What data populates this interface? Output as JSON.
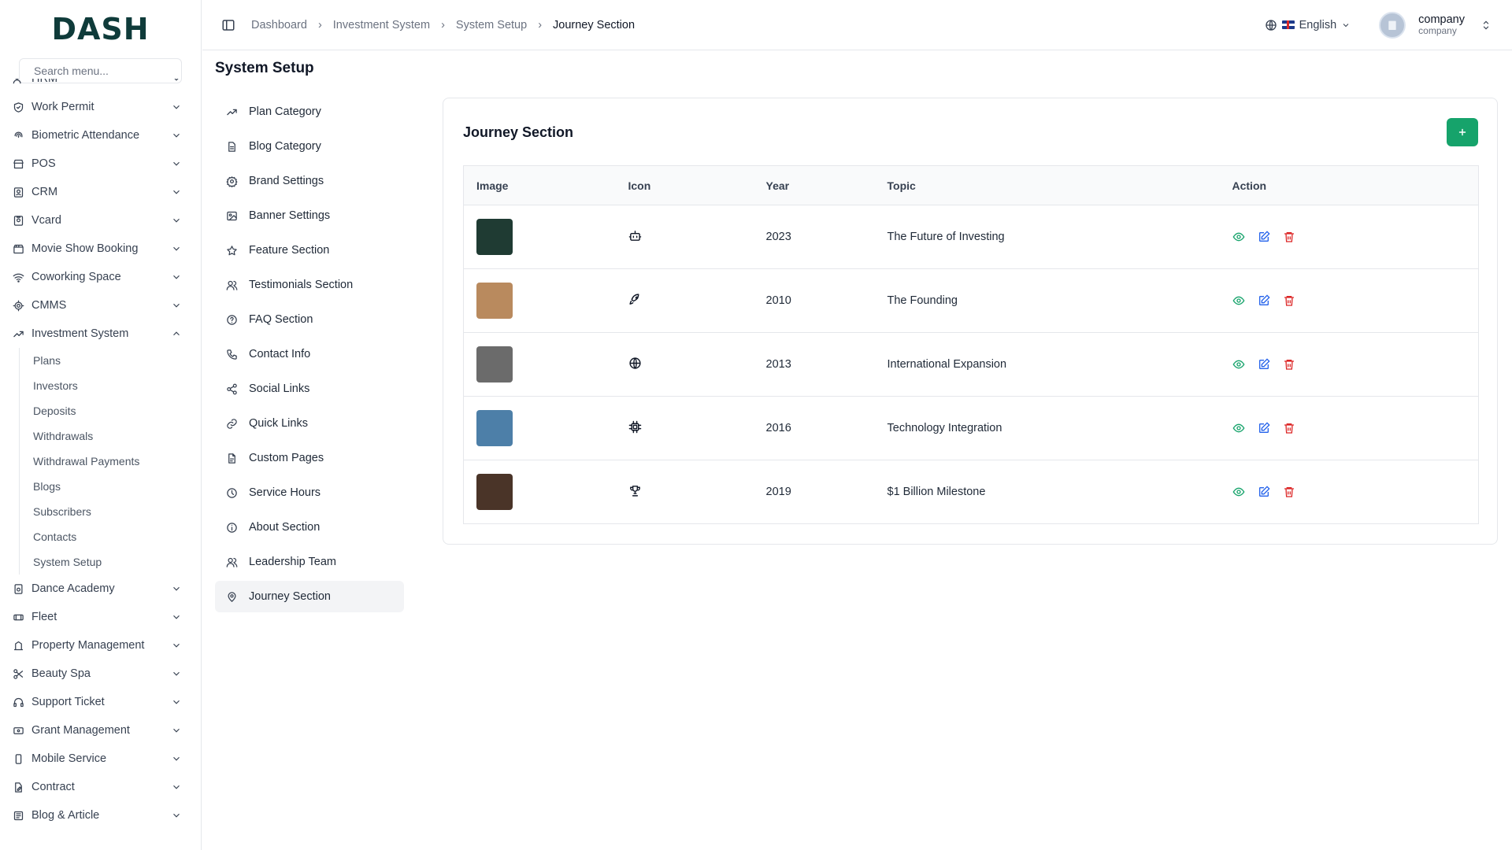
{
  "app": {
    "logo": "DASH"
  },
  "search": {
    "placeholder": "Search menu..."
  },
  "sidebar": {
    "cut_item": "HRM",
    "items": [
      {
        "label": "Work Permit",
        "icon": "shield-check-icon"
      },
      {
        "label": "Biometric Attendance",
        "icon": "fingerprint-icon"
      },
      {
        "label": "POS",
        "icon": "store-icon"
      },
      {
        "label": "CRM",
        "icon": "contact-icon"
      },
      {
        "label": "Vcard",
        "icon": "id-card-icon"
      },
      {
        "label": "Movie Show Booking",
        "icon": "clapperboard-icon"
      },
      {
        "label": "Coworking Space",
        "icon": "wifi-icon"
      },
      {
        "label": "CMMS",
        "icon": "cog-icon"
      },
      {
        "label": "Investment System",
        "icon": "trending-up-icon",
        "expanded": true
      }
    ],
    "submenu": [
      "Plans",
      "Investors",
      "Deposits",
      "Withdrawals",
      "Withdrawal Payments",
      "Blogs",
      "Subscribers",
      "Contacts",
      "System Setup"
    ],
    "items_after": [
      {
        "label": "Dance Academy",
        "icon": "music-icon"
      },
      {
        "label": "Fleet",
        "icon": "car-icon"
      },
      {
        "label": "Property Management",
        "icon": "building-icon"
      },
      {
        "label": "Beauty Spa",
        "icon": "scissors-icon"
      },
      {
        "label": "Support Ticket",
        "icon": "headphones-icon"
      },
      {
        "label": "Grant Management",
        "icon": "banknote-icon"
      },
      {
        "label": "Mobile Service",
        "icon": "smartphone-icon"
      },
      {
        "label": "Contract",
        "icon": "file-pen-icon"
      },
      {
        "label": "Blog & Article",
        "icon": "newspaper-icon"
      }
    ]
  },
  "breadcrumb": [
    "Dashboard",
    "Investment System",
    "System Setup",
    "Journey Section"
  ],
  "header": {
    "language": "English",
    "user_name": "company",
    "user_role": "company"
  },
  "page": {
    "title": "System Setup"
  },
  "setup_nav": [
    {
      "label": "Plan Category",
      "icon": "trending-up-icon"
    },
    {
      "label": "Blog Category",
      "icon": "file-text-icon"
    },
    {
      "label": "Brand Settings",
      "icon": "gear-icon"
    },
    {
      "label": "Banner Settings",
      "icon": "image-icon"
    },
    {
      "label": "Feature Section",
      "icon": "star-icon"
    },
    {
      "label": "Testimonials Section",
      "icon": "users-icon"
    },
    {
      "label": "FAQ Section",
      "icon": "help-circle-icon"
    },
    {
      "label": "Contact Info",
      "icon": "phone-icon"
    },
    {
      "label": "Social Links",
      "icon": "share-icon"
    },
    {
      "label": "Quick Links",
      "icon": "link-icon"
    },
    {
      "label": "Custom Pages",
      "icon": "file-icon"
    },
    {
      "label": "Service Hours",
      "icon": "clock-icon"
    },
    {
      "label": "About Section",
      "icon": "info-icon"
    },
    {
      "label": "Leadership Team",
      "icon": "users-icon"
    },
    {
      "label": "Journey Section",
      "icon": "map-pin-icon",
      "active": true
    }
  ],
  "card": {
    "title": "Journey Section"
  },
  "table": {
    "headers": [
      "Image",
      "Icon",
      "Year",
      "Topic",
      "Action"
    ],
    "rows": [
      {
        "year": "2023",
        "topic": "The Future of Investing",
        "icon": "bot-icon",
        "thumb_color": "#1f3b33"
      },
      {
        "year": "2010",
        "topic": "The Founding",
        "icon": "rocket-icon",
        "thumb_color": "#b98a5e"
      },
      {
        "year": "2013",
        "topic": "International Expansion",
        "icon": "globe-icon",
        "thumb_color": "#6b6b6b"
      },
      {
        "year": "2016",
        "topic": "Technology Integration",
        "icon": "cpu-icon",
        "thumb_color": "#4d7fa8"
      },
      {
        "year": "2019",
        "topic": "$1 Billion Milestone",
        "icon": "trophy-icon",
        "thumb_color": "#4a3428"
      }
    ]
  },
  "colors": {
    "accent": "#16a36b",
    "view": "#16a36b",
    "edit": "#2563eb",
    "delete": "#dc2626"
  }
}
